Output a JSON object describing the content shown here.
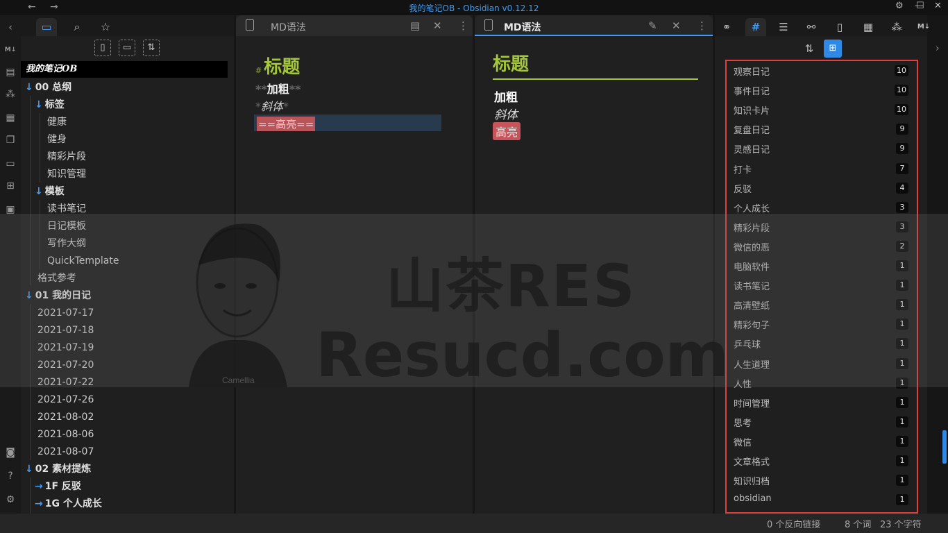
{
  "window": {
    "title": "我的笔记OB - Obsidian v0.12.12",
    "back": "←",
    "forward": "→",
    "controls": [
      "⚙",
      "—",
      "☐",
      "✕"
    ]
  },
  "ribbon_icons": [
    "back-icon",
    "markdown-icon",
    "file-icon",
    "graph-icon",
    "calendar-icon",
    "copy-icon",
    "slides-icon",
    "layout-icon",
    "archive-icon",
    "vault-icon",
    "help-icon",
    "settings-icon"
  ],
  "explorer": {
    "vault_name": "我的笔记OB",
    "items": [
      {
        "label": "00 总纲",
        "level": 0,
        "folder": true
      },
      {
        "label": "标签",
        "level": 1,
        "folder": true
      },
      {
        "label": "健康",
        "level": 2
      },
      {
        "label": "健身",
        "level": 2
      },
      {
        "label": "精彩片段",
        "level": 2
      },
      {
        "label": "知识管理",
        "level": 2
      },
      {
        "label": "模板",
        "level": 1,
        "folder": true
      },
      {
        "label": "读书笔记",
        "level": 2
      },
      {
        "label": "日记模板",
        "level": 2
      },
      {
        "label": "写作大纲",
        "level": 2
      },
      {
        "label": "QuickTemplate",
        "level": 2
      },
      {
        "label": "格式参考",
        "level": 1
      },
      {
        "label": "01 我的日记",
        "level": 0,
        "folder": true
      },
      {
        "label": "2021-07-17",
        "level": 1
      },
      {
        "label": "2021-07-18",
        "level": 1
      },
      {
        "label": "2021-07-19",
        "level": 1
      },
      {
        "label": "2021-07-20",
        "level": 1
      },
      {
        "label": "2021-07-22",
        "level": 1
      },
      {
        "label": "2021-07-26",
        "level": 1
      },
      {
        "label": "2021-08-02",
        "level": 1
      },
      {
        "label": "2021-08-06",
        "level": 1
      },
      {
        "label": "2021-08-07",
        "level": 1
      },
      {
        "label": "02 素材提炼",
        "level": 0,
        "folder": true
      },
      {
        "label": "1F 反驳",
        "level": 1,
        "folder": true,
        "collapsed": true
      },
      {
        "label": "1G 个人成长",
        "level": 1,
        "folder": true,
        "collapsed": true
      }
    ]
  },
  "editor_source": {
    "tab_title": "MD语法",
    "heading_mark": "#",
    "heading": "标题",
    "bold_mark": "**",
    "bold": "加粗",
    "italic_mark": "*",
    "italic": "斜体",
    "highlight_raw": "==高亮=="
  },
  "editor_preview": {
    "tab_title": "MD语法",
    "heading": "标题",
    "bold": "加粗",
    "italic": "斜体",
    "highlight": "高亮"
  },
  "tags": [
    {
      "name": "观察日记",
      "count": "10"
    },
    {
      "name": "事件日记",
      "count": "10"
    },
    {
      "name": "知识卡片",
      "count": "10"
    },
    {
      "name": "复盘日记",
      "count": "9"
    },
    {
      "name": "灵感日记",
      "count": "9"
    },
    {
      "name": "打卡",
      "count": "7"
    },
    {
      "name": "反驳",
      "count": "4"
    },
    {
      "name": "个人成长",
      "count": "3"
    },
    {
      "name": "精彩片段",
      "count": "3"
    },
    {
      "name": "微信的恶",
      "count": "2"
    },
    {
      "name": "电脑软件",
      "count": "1"
    },
    {
      "name": "读书笔记",
      "count": "1"
    },
    {
      "name": "高清壁纸",
      "count": "1"
    },
    {
      "name": "精彩句子",
      "count": "1"
    },
    {
      "name": "乒乓球",
      "count": "1"
    },
    {
      "name": "人生道理",
      "count": "1"
    },
    {
      "name": "人性",
      "count": "1"
    },
    {
      "name": "时间管理",
      "count": "1"
    },
    {
      "name": "思考",
      "count": "1"
    },
    {
      "name": "微信",
      "count": "1"
    },
    {
      "name": "文章格式",
      "count": "1"
    },
    {
      "name": "知识归档",
      "count": "1"
    },
    {
      "name": "obsidian",
      "count": "1"
    }
  ],
  "status": {
    "backlinks": "0 个反向链接",
    "words": "8 个词",
    "chars": "23 个字符"
  },
  "watermark": {
    "line1": "山茶RES",
    "line2": "Resucd.com",
    "logo_text": "Camellia"
  },
  "colors": {
    "accent": "#3f9cf5",
    "heading": "#a4c639",
    "highlight": "#c5555b",
    "tag_box": "#e0403f"
  }
}
